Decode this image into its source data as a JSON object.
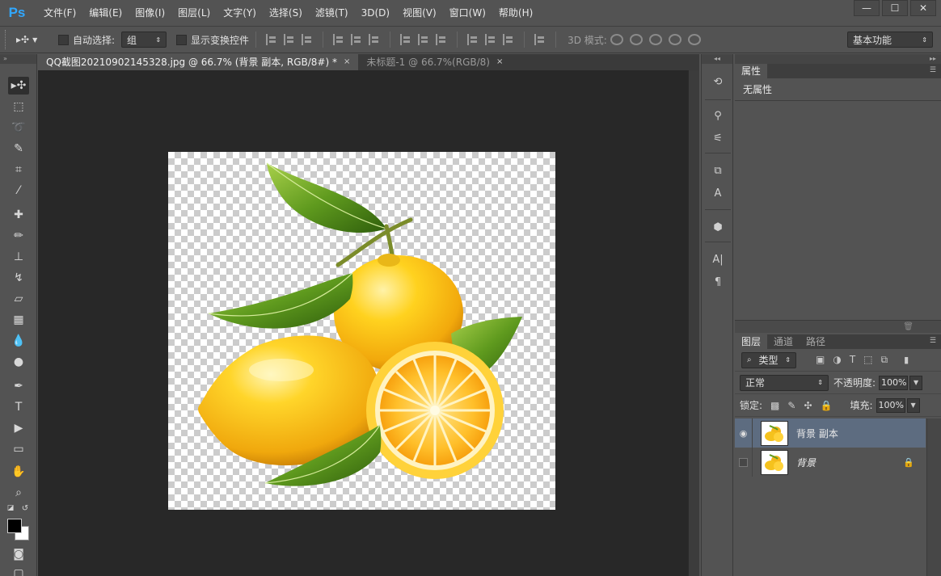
{
  "app": {
    "logo": "Ps"
  },
  "menu": [
    "文件(F)",
    "编辑(E)",
    "图像(I)",
    "图层(L)",
    "文字(Y)",
    "选择(S)",
    "滤镜(T)",
    "3D(D)",
    "视图(V)",
    "窗口(W)",
    "帮助(H)"
  ],
  "window": {
    "minimize": "—",
    "maximize": "☐",
    "close": "✕"
  },
  "options": {
    "auto_select_label": "自动选择:",
    "auto_select_value": "组",
    "show_transform_label": "显示变换控件",
    "mode3d_label": "3D 模式:",
    "workspace_value": "基本功能"
  },
  "tabs": [
    {
      "title": "QQ截图20210902145328.jpg @ 66.7% (背景 副本, RGB/8#) *",
      "close": "×"
    },
    {
      "title": "未标题-1 @ 66.7%(RGB/8)",
      "close": "×"
    }
  ],
  "properties": {
    "tab": "属性",
    "body": "无属性"
  },
  "layers_panel": {
    "tabs": [
      "图层",
      "通道",
      "路径"
    ],
    "filter_value": "类型",
    "blend_value": "正常",
    "opacity_label": "不透明度:",
    "opacity_value": "100%",
    "lock_label": "锁定:",
    "fill_label": "填充:",
    "fill_value": "100%",
    "layers": [
      {
        "name": "背景 副本",
        "visible": true,
        "selected": true,
        "locked": false
      },
      {
        "name": "背景",
        "visible": false,
        "selected": false,
        "locked": true
      }
    ]
  },
  "colors": {
    "foreground": "#000000",
    "background": "#ffffff",
    "selected_layer": "#5d6c80",
    "panel": "#535353",
    "workspace": "#282828"
  }
}
